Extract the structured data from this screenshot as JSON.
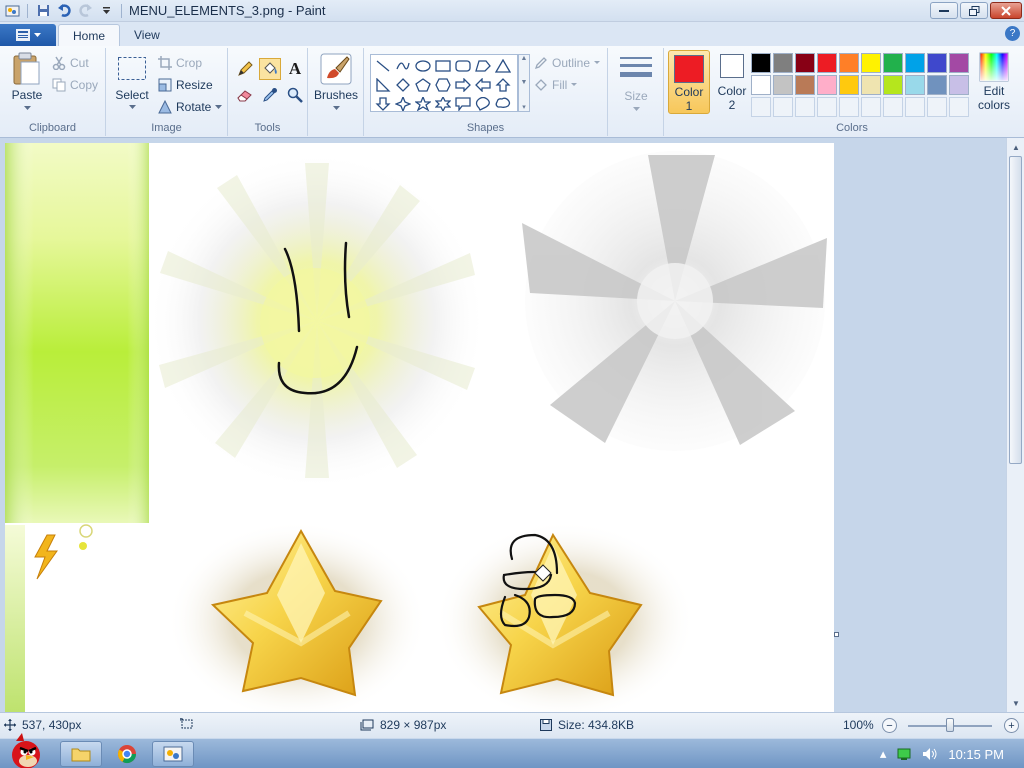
{
  "window": {
    "title": "MENU_ELEMENTS_3.png - Paint"
  },
  "tabs": [
    {
      "label": "Home"
    },
    {
      "label": "View"
    }
  ],
  "ribbon": {
    "clipboard": {
      "label": "Clipboard",
      "paste": "Paste",
      "cut": "Cut",
      "copy": "Copy"
    },
    "image": {
      "label": "Image",
      "select": "Select",
      "crop": "Crop",
      "resize": "Resize",
      "rotate": "Rotate"
    },
    "tools": {
      "label": "Tools"
    },
    "brushes": {
      "label": "Brushes"
    },
    "shapes": {
      "label": "Shapes",
      "outline": "Outline",
      "fill": "Fill"
    },
    "size": {
      "label": "Size"
    },
    "color1": {
      "label": "Color",
      "number": "1",
      "value": "#ed1c24"
    },
    "color2": {
      "label": "Color",
      "number": "2",
      "value": "#ffffff"
    },
    "colors": {
      "label": "Colors",
      "edit": "Edit",
      "edit2": "colors"
    },
    "palette_row1": [
      "#000000",
      "#7f7f7f",
      "#880015",
      "#ed1c24",
      "#ff7f27",
      "#fff200",
      "#22b14c",
      "#00a2e8",
      "#3f48cc",
      "#a349a4"
    ],
    "palette_row2": [
      "#ffffff",
      "#c3c3c3",
      "#b97a57",
      "#ffaec9",
      "#ffc90e",
      "#efe4b0",
      "#b5e61d",
      "#99d9ea",
      "#7092be",
      "#c8bfe7"
    ]
  },
  "status": {
    "cursor": "537, 430px",
    "dimensions": "829 × 987px",
    "size": "Size: 434.8KB",
    "zoom": "100%"
  },
  "taskbar": {
    "time": "10:15 PM"
  }
}
